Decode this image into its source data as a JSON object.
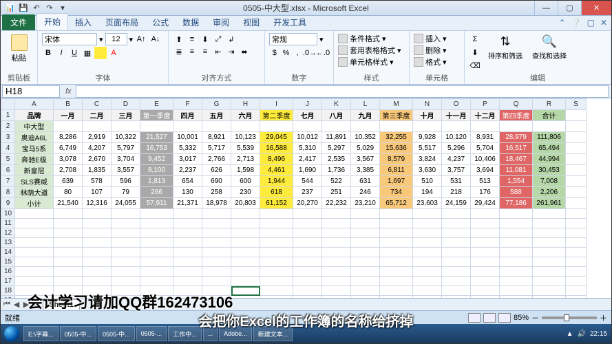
{
  "window": {
    "title": "0505-中大型.xlsx - Microsoft Excel",
    "qat": {
      "save": "💾",
      "undo": "↶",
      "redo": "↷",
      "down": "▾"
    }
  },
  "tabs": {
    "file": "文件",
    "home": "开始",
    "insert": "插入",
    "layout": "页面布局",
    "formulas": "公式",
    "data": "数据",
    "review": "审阅",
    "view": "视图",
    "dev": "开发工具"
  },
  "ribbon": {
    "clipboard": {
      "label": "剪贴板",
      "paste": "粘贴"
    },
    "font": {
      "label": "字体",
      "name": "宋体",
      "size": "12",
      "bold": "B",
      "italic": "I",
      "under": "U"
    },
    "align": {
      "label": "对齐方式"
    },
    "number": {
      "label": "数字",
      "format": "常规"
    },
    "styles": {
      "label": "样式",
      "cond": "条件格式",
      "table": "套用表格格式",
      "cell": "单元格样式"
    },
    "cells": {
      "label": "单元格",
      "insert": "插入",
      "delete": "删除",
      "format": "格式"
    },
    "editing": {
      "label": "编辑",
      "sort": "排序和筛选",
      "find": "查找和选择"
    }
  },
  "formula_bar": {
    "name_box": "H18",
    "fx": "fx"
  },
  "columns": [
    "",
    "A",
    "B",
    "C",
    "D",
    "E",
    "F",
    "G",
    "H",
    "I",
    "J",
    "K",
    "L",
    "M",
    "N",
    "O",
    "P",
    "Q",
    "R",
    "S"
  ],
  "header_row": [
    "品牌",
    "一月",
    "二月",
    "三月",
    "第一季度",
    "四月",
    "五月",
    "六月",
    "第二季度",
    "七月",
    "八月",
    "九月",
    "第三季度",
    "十月",
    "十一月",
    "十二月",
    "第四季度",
    "合计"
  ],
  "category": "中大型",
  "rows": [
    {
      "brand": "奥迪A6L",
      "v": [
        "8,286",
        "2,919",
        "10,322",
        "21,527",
        "10,001",
        "8,921",
        "10,123",
        "29,045",
        "10,012",
        "11,891",
        "10,352",
        "32,255",
        "9,928",
        "10,120",
        "8,931",
        "28,979",
        "111,806"
      ]
    },
    {
      "brand": "宝马5系",
      "v": [
        "6,749",
        "4,207",
        "5,797",
        "16,753",
        "5,332",
        "5,717",
        "5,539",
        "16,588",
        "5,310",
        "5,297",
        "5,029",
        "15,636",
        "5,517",
        "5,296",
        "5,704",
        "16,517",
        "65,494"
      ]
    },
    {
      "brand": "奔驰E级",
      "v": [
        "3,078",
        "2,670",
        "3,704",
        "9,452",
        "3,017",
        "2,766",
        "2,713",
        "8,496",
        "2,417",
        "2,535",
        "3,567",
        "8,579",
        "3,824",
        "4,237",
        "10,406",
        "18,467",
        "44,994"
      ]
    },
    {
      "brand": "新皇冠",
      "v": [
        "2,708",
        "1,835",
        "3,557",
        "8,100",
        "2,237",
        "626",
        "1,598",
        "4,461",
        "1,690",
        "1,736",
        "3,385",
        "6,811",
        "3,630",
        "3,757",
        "3,694",
        "11,081",
        "30,453"
      ]
    },
    {
      "brand": "SLS赛威",
      "v": [
        "639",
        "578",
        "596",
        "1,813",
        "654",
        "690",
        "600",
        "1,944",
        "544",
        "522",
        "631",
        "1,697",
        "510",
        "531",
        "513",
        "1,554",
        "7,008"
      ]
    },
    {
      "brand": "林荫大道",
      "v": [
        "80",
        "107",
        "79",
        "266",
        "130",
        "258",
        "230",
        "618",
        "237",
        "251",
        "246",
        "734",
        "194",
        "218",
        "176",
        "588",
        "2,206"
      ]
    },
    {
      "brand": "小计",
      "v": [
        "21,540",
        "12,316",
        "24,055",
        "57,911",
        "21,371",
        "18,978",
        "20,803",
        "61,152",
        "20,270",
        "22,232",
        "23,210",
        "65,712",
        "23,603",
        "24,159",
        "29,424",
        "77,186",
        "261,961"
      ]
    }
  ],
  "sheet_tabs": {
    "s1": "Sheet1"
  },
  "status": {
    "ready": "就绪",
    "zoom": "85%"
  },
  "taskbar": {
    "items": [
      "E:\\字幕...",
      "0505-中...",
      "0505-中...",
      "0505-...",
      "工作中...",
      "...",
      "Adobe...",
      "新建文本..."
    ],
    "time": "22:15"
  },
  "overlay": {
    "qq_text": "会计学习请加QQ群162473106",
    "subtitle": "会把你Excel的工作簿的名称给挤掉"
  },
  "icons": {
    "tri": "▾",
    "inc": "A▲",
    "dec": "A▼",
    "sigma": "Σ",
    "sort": "⇅",
    "find": "🔍"
  }
}
